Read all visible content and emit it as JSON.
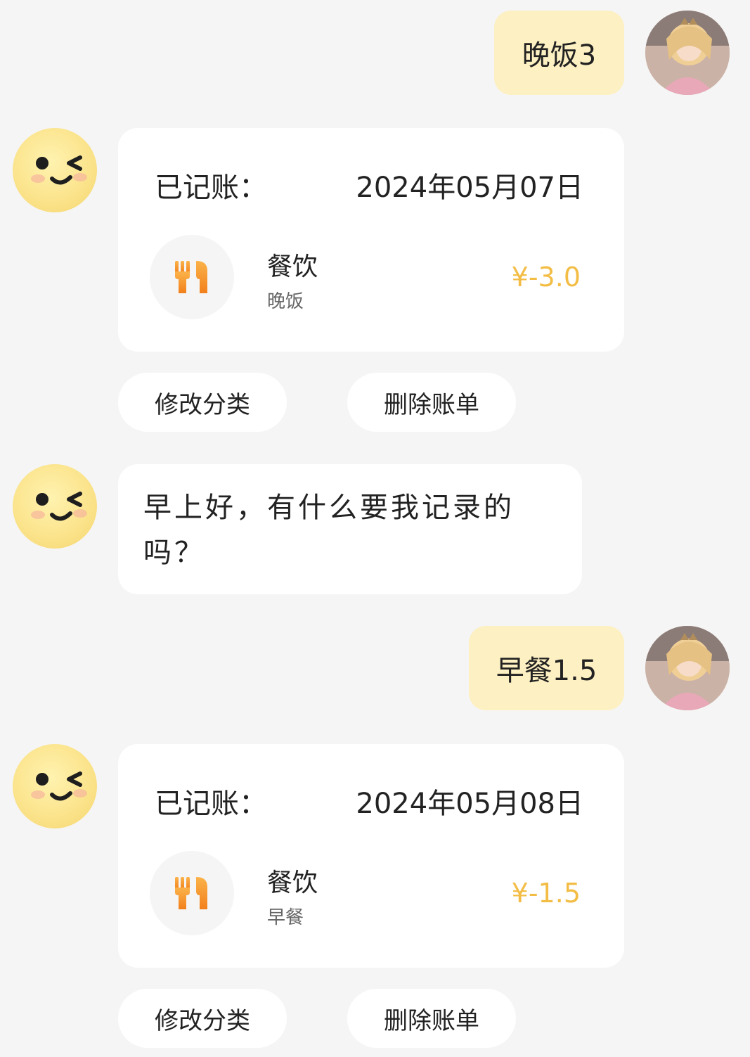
{
  "messages": {
    "user_1": "晚饭3",
    "user_2": "早餐1.5",
    "bot_greeting": "早上好，有什么要我记录的吗？"
  },
  "records": [
    {
      "label": "已记账：",
      "date": "2024年05月07日",
      "category": "餐饮",
      "note": "晚饭",
      "amount": "¥-3.0",
      "icon": "fork-knife-icon"
    },
    {
      "label": "已记账：",
      "date": "2024年05月08日",
      "category": "餐饮",
      "note": "早餐",
      "amount": "¥-1.5",
      "icon": "fork-knife-icon"
    }
  ],
  "actions": {
    "edit_category": "修改分类",
    "delete_bill": "删除账单"
  },
  "colors": {
    "background": "#f5f5f5",
    "user_bubble": "#fdf0c3",
    "card": "#ffffff",
    "amount": "#f3bd45",
    "icon_orange": "#f59a2c",
    "bot_avatar": "#fbe48d"
  }
}
